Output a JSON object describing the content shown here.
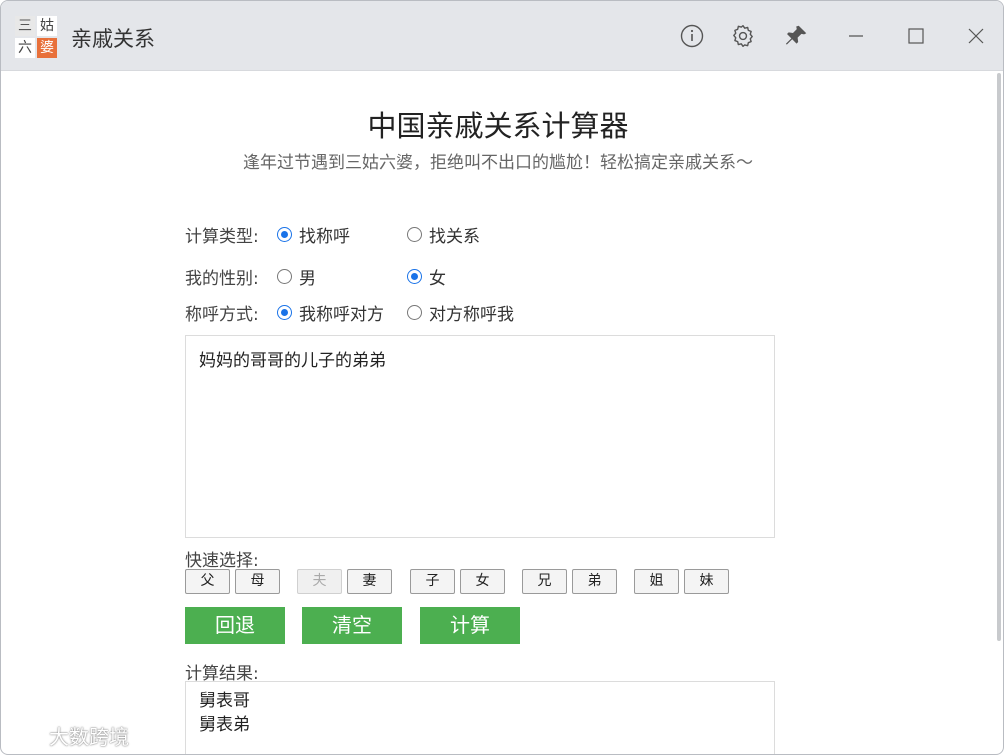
{
  "titlebar": {
    "logo": [
      "三",
      "姑",
      "六",
      "婆"
    ],
    "title": "亲戚关系",
    "icons": [
      "info-icon",
      "gear-icon",
      "pin-icon",
      "minimize-icon",
      "maximize-icon",
      "close-icon"
    ]
  },
  "header": {
    "title": "中国亲戚关系计算器",
    "subtitle": "逢年过节遇到三姑六婆，拒绝叫不出口的尴尬！轻松搞定亲戚关系～"
  },
  "form": {
    "calc_type": {
      "label": "计算类型:",
      "options": [
        "找称呼",
        "找关系"
      ],
      "selected": "找称呼"
    },
    "gender": {
      "label": "我的性别:",
      "options": [
        "男",
        "女"
      ],
      "selected": "女"
    },
    "address_mode": {
      "label": "称呼方式:",
      "options": [
        "我称呼对方",
        "对方称呼我"
      ],
      "selected": "我称呼对方"
    },
    "input_value": "妈妈的哥哥的儿子的弟弟"
  },
  "quick": {
    "label": "快速选择:",
    "buttons": [
      {
        "label": "父",
        "disabled": false
      },
      {
        "label": "母",
        "disabled": false
      },
      {
        "label": "夫",
        "disabled": true
      },
      {
        "label": "妻",
        "disabled": false
      },
      {
        "label": "子",
        "disabled": false
      },
      {
        "label": "女",
        "disabled": false
      },
      {
        "label": "兄",
        "disabled": false
      },
      {
        "label": "弟",
        "disabled": false
      },
      {
        "label": "姐",
        "disabled": false
      },
      {
        "label": "妹",
        "disabled": false
      }
    ]
  },
  "actions": {
    "back": "回退",
    "clear": "清空",
    "calc": "计算"
  },
  "result": {
    "label": "计算结果:",
    "lines": [
      "舅表哥",
      "舅表弟"
    ]
  },
  "watermark": "大数跨境",
  "colors": {
    "accent": "#4caf50",
    "radio": "#1a73e8",
    "titlebar": "#e4e6ea"
  }
}
